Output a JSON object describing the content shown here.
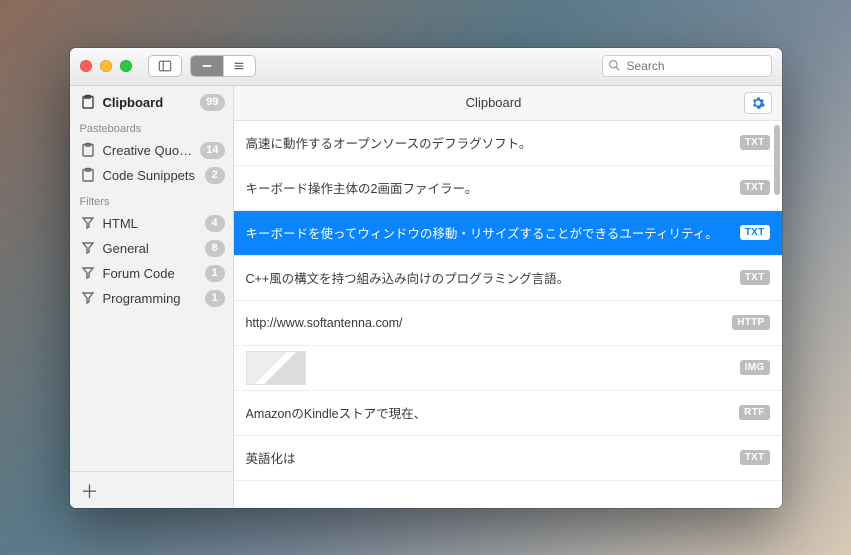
{
  "search": {
    "placeholder": "Search"
  },
  "sidebar": {
    "clipboard": {
      "label": "Clipboard",
      "count": "99"
    },
    "pasteboards_label": "Pasteboards",
    "pasteboards": [
      {
        "label": "Creative Quotes",
        "count": "14"
      },
      {
        "label": "Code Sunippets",
        "count": "2"
      }
    ],
    "filters_label": "Filters",
    "filters": [
      {
        "label": "HTML",
        "count": "4"
      },
      {
        "label": "General",
        "count": "8"
      },
      {
        "label": "Forum Code",
        "count": "1"
      },
      {
        "label": "Programming",
        "count": "1"
      }
    ]
  },
  "main": {
    "title": "Clipboard",
    "items": [
      {
        "text": "高速に動作するオープンソースのデフラグソフト。",
        "type": "TXT"
      },
      {
        "text": "キーボード操作主体の2画面ファイラー。",
        "type": "TXT"
      },
      {
        "text": "キーボードを使ってウィンドウの移動・リサイズすることができるユーティリティ。",
        "type": "TXT",
        "selected": true
      },
      {
        "text": "C++風の構文を持つ組み込み向けのプログラミング言語。",
        "type": "TXT"
      },
      {
        "text": "http://www.softantenna.com/",
        "type": "HTTP"
      },
      {
        "text": "",
        "type": "IMG",
        "thumb": true
      },
      {
        "text": "AmazonのKindleストアで現在、",
        "type": "RTF"
      },
      {
        "text": "英語化は",
        "type": "TXT"
      }
    ]
  }
}
